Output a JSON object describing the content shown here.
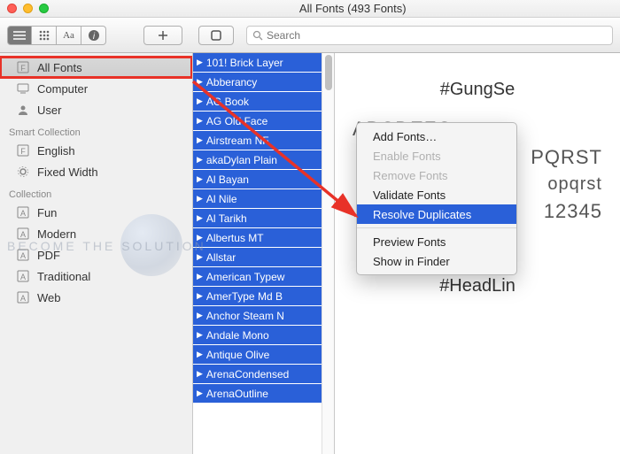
{
  "window": {
    "title": "All Fonts (493 Fonts)"
  },
  "search": {
    "placeholder": "Search"
  },
  "sidebar": {
    "main": [
      {
        "label": "All Fonts",
        "icon": "font-square-icon"
      },
      {
        "label": "Computer",
        "icon": "computer-icon"
      },
      {
        "label": "User",
        "icon": "user-icon"
      }
    ],
    "smart_header": "Smart Collection",
    "smart": [
      {
        "label": "English",
        "icon": "font-square-icon"
      },
      {
        "label": "Fixed Width",
        "icon": "gear-icon"
      }
    ],
    "coll_header": "Collection",
    "coll": [
      {
        "label": "Fun",
        "icon": "a-square-icon"
      },
      {
        "label": "Modern",
        "icon": "a-square-icon"
      },
      {
        "label": "PDF",
        "icon": "a-square-icon"
      },
      {
        "label": "Traditional",
        "icon": "a-square-icon"
      },
      {
        "label": "Web",
        "icon": "a-square-icon"
      }
    ]
  },
  "fonts": [
    "101! Brick Layer",
    "Abberancy",
    "AG Book",
    "AG Old Face",
    "Airstream NF",
    "akaDylan Plain",
    "Al Bayan",
    "Al Nile",
    "Al Tarikh",
    "Albertus MT",
    "Allstar",
    "American Typew",
    "AmerType Md B",
    "Anchor Steam N",
    "Andale Mono",
    "Antique Olive",
    "ArenaCondensed",
    "ArenaOutline"
  ],
  "context_menu": {
    "items": [
      {
        "label": "Add Fonts…",
        "disabled": false
      },
      {
        "label": "Enable Fonts",
        "disabled": true
      },
      {
        "label": "Remove Fonts",
        "disabled": true
      },
      {
        "label": "Validate Fonts",
        "disabled": false
      },
      {
        "label": "Resolve Duplicates",
        "disabled": false,
        "hover": true
      },
      {
        "sep": true
      },
      {
        "label": "Preview Fonts",
        "disabled": false
      },
      {
        "label": "Show in Finder",
        "disabled": false
      }
    ]
  },
  "preview": {
    "name1": "#GungSe",
    "upper": "ABCDEFG",
    "upper2": "PQRST",
    "lower": "opqrst",
    "digits": "12345",
    "name2": "#HeadLin"
  },
  "watermark": "BECOME THE SOLUTION"
}
